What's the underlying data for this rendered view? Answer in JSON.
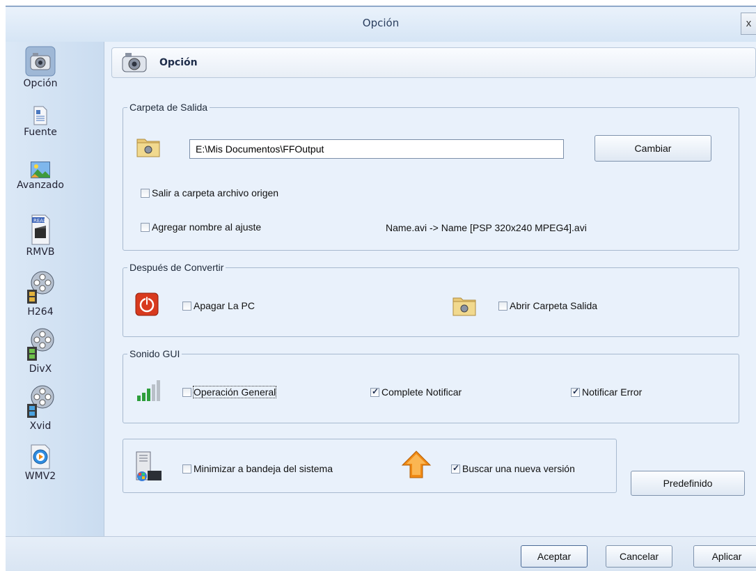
{
  "window": {
    "title": "Opción",
    "close_glyph": "x"
  },
  "sidebar": {
    "items": [
      {
        "label": "Opción",
        "icon": "settings-camera-icon"
      },
      {
        "label": "Fuente",
        "icon": "document-icon"
      },
      {
        "label": "Avanzado",
        "icon": "landscape-image-icon"
      },
      {
        "label": "RMVB",
        "icon": "realmedia-icon"
      },
      {
        "label": "H264",
        "icon": "film-reel-icon"
      },
      {
        "label": "DivX",
        "icon": "film-reel-icon"
      },
      {
        "label": "Xvid",
        "icon": "film-reel-icon"
      },
      {
        "label": "WMV2",
        "icon": "windows-media-icon"
      }
    ]
  },
  "header": {
    "title": "Opción"
  },
  "output_folder": {
    "legend": "Carpeta de Salida",
    "path": "E:\\Mis Documentos\\FFOutput",
    "change_button": "Cambiar",
    "source_folder_label": "Salir a carpeta archivo origen",
    "source_folder_checked": false,
    "append_name_label": "Agregar nombre al ajuste",
    "append_name_checked": false,
    "name_example": "Name.avi  -> Name [PSP 320x240 MPEG4].avi"
  },
  "after_convert": {
    "legend": "Después de Convertir",
    "shutdown_label": "Apagar La PC",
    "shutdown_checked": false,
    "open_folder_label": "Abrir Carpeta Salida",
    "open_folder_checked": false
  },
  "sound_gui": {
    "legend": "Sonido GUI",
    "general_label": "Operación General",
    "general_checked": false,
    "complete_label": "Complete Notificar",
    "complete_checked": true,
    "error_label": "Notificar Error",
    "error_checked": true
  },
  "misc": {
    "minimize_label": "Minimizar a bandeja del sistema",
    "minimize_checked": false,
    "update_label": "Buscar una nueva versión",
    "update_checked": true,
    "default_button": "Predefinido"
  },
  "footer": {
    "ok": "Aceptar",
    "cancel": "Cancelar",
    "apply": "Aplicar"
  },
  "colors": {
    "accent": "#2a3e5e",
    "sidebar": "#d3e3f4",
    "power_red": "#d83a1e",
    "arrow_orange": "#f08a14",
    "signal_green": "#2e9e3c"
  }
}
